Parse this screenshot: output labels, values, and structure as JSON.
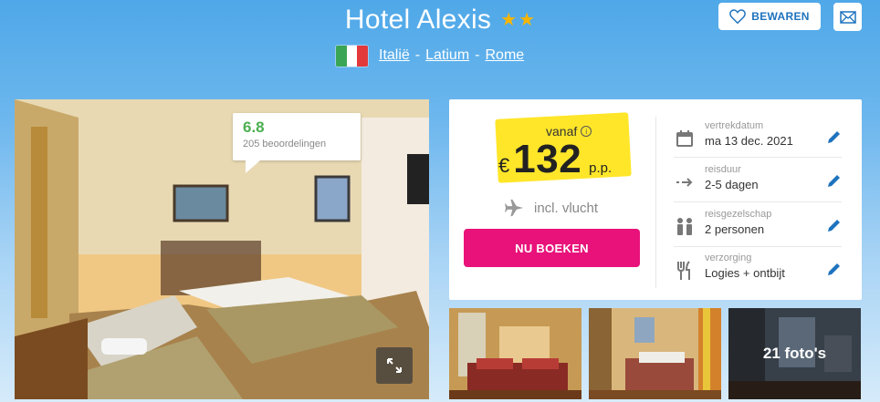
{
  "hotel": {
    "name": "Hotel Alexis",
    "stars": 2
  },
  "breadcrumb": {
    "items": [
      "Italië",
      "Latium",
      "Rome"
    ],
    "separator": "-"
  },
  "header_actions": {
    "save_label": "BEWAREN"
  },
  "rating": {
    "score": "6.8",
    "reviews": "205 beoordelingen"
  },
  "price": {
    "from_label": "vanaf",
    "currency": "€",
    "amount": "132",
    "per_person": "p.p.",
    "flight_label": "incl. vlucht"
  },
  "book_button": "NU BOEKEN",
  "details": [
    {
      "icon": "calendar-icon",
      "label": "vertrekdatum",
      "value": "ma 13 dec. 2021"
    },
    {
      "icon": "duration-arrow-icon",
      "label": "reisduur",
      "value": "2-5 dagen"
    },
    {
      "icon": "people-icon",
      "label": "reisgezelschap",
      "value": "2 personen"
    },
    {
      "icon": "cutlery-icon",
      "label": "verzorging",
      "value": "Logies + ontbijt"
    }
  ],
  "gallery": {
    "more_label": "21 foto's"
  },
  "colors": {
    "accent_pink": "#e8127a",
    "price_yellow": "#ffe629",
    "link_blue": "#1e73be",
    "rating_green": "#4caf50"
  }
}
